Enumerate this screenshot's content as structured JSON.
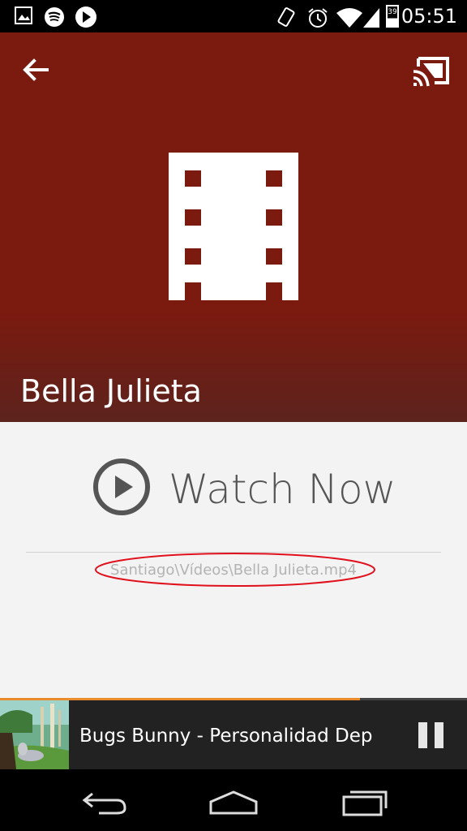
{
  "status_bar": {
    "time": "05:51",
    "battery": "39",
    "left_icons": [
      "image-icon",
      "spotify-icon",
      "play-store-icon"
    ],
    "right_icons": [
      "vibrate-icon",
      "alarm-icon",
      "wifi-icon",
      "signal-icon",
      "battery-icon"
    ]
  },
  "hero": {
    "back_icon": "arrow-back-icon",
    "cast_icon": "cast-icon",
    "media_icon": "film-strip-icon",
    "title": "Bella Julieta",
    "background_color": "#7b1a0f"
  },
  "main": {
    "watch_label": "Watch Now",
    "play_icon": "play-circle-icon",
    "file_path": "Santiago\\Vídeos\\Bella Julieta.mp4",
    "highlight_color": "#e0101c"
  },
  "mini_player": {
    "title": "Bugs Bunny - Personalidad Dep",
    "progress": 0.77,
    "pause_icon": "pause-icon",
    "accent_color": "#e98b2b"
  },
  "nav_bar": {
    "buttons": [
      "back-icon",
      "home-icon",
      "recents-icon"
    ]
  }
}
